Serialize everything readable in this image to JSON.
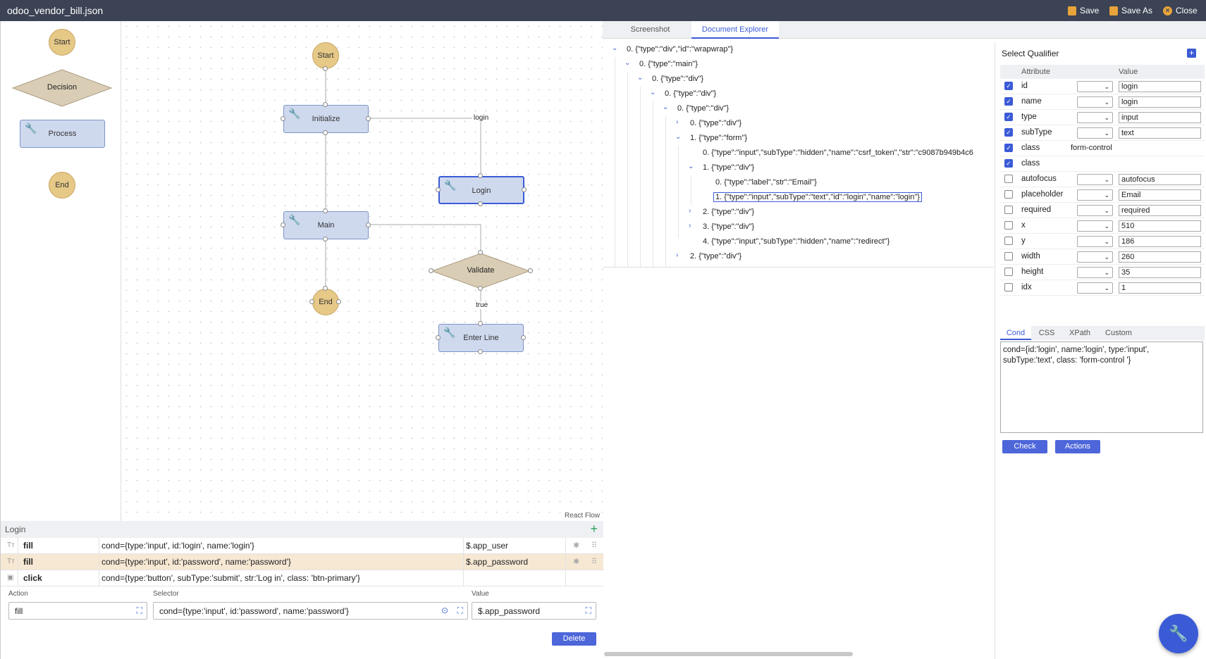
{
  "titlebar": {
    "filename": "odoo_vendor_bill.json",
    "save": "Save",
    "save_as": "Save As",
    "close": "Close"
  },
  "palette": {
    "start": "Start",
    "decision": "Decision",
    "process": "Process",
    "end": "End"
  },
  "flow": {
    "nodes": {
      "start": "Start",
      "initialize": "Initialize",
      "login": "Login",
      "main": "Main",
      "validate": "Validate",
      "end": "End",
      "enter_line": "Enter Line"
    },
    "edge_labels": {
      "login": "login",
      "true": "true"
    },
    "attribution": "React Flow"
  },
  "steps": {
    "title": "Login",
    "rows": [
      {
        "icon": "text-icon",
        "action": "fill",
        "selector": "cond={type:'input', id:'login', name:'login'}",
        "value": "$.app_user"
      },
      {
        "icon": "text-icon",
        "action": "fill",
        "selector": "cond={type:'input', id:'password', name:'password'}",
        "value": "$.app_password"
      },
      {
        "icon": "mouse-icon",
        "action": "click",
        "selector": "cond={type:'button', subType:'submit', str:'Log in', class: 'btn-primary'}",
        "value": ""
      }
    ],
    "editor": {
      "action_label": "Action",
      "selector_label": "Selector",
      "value_label": "Value",
      "action": "fill",
      "selector": "cond={type:'input', id:'password', name:'password'}",
      "value": "$.app_password",
      "delete": "Delete"
    }
  },
  "tabs": {
    "screenshot": "Screenshot",
    "document_explorer": "Document Explorer"
  },
  "tree": [
    "0. {\"type\":\"div\",\"id\":\"wrapwrap\"}",
    "0. {\"type\":\"main\"}",
    "0. {\"type\":\"div\"}",
    "0. {\"type\":\"div\"}",
    "0. {\"type\":\"div\"}",
    "0. {\"type\":\"div\"}",
    "1. {\"type\":\"form\"}",
    "0. {\"type\":\"input\",\"subType\":\"hidden\",\"name\":\"csrf_token\",\"str\":\"c9087b949b4c6",
    "1. {\"type\":\"div\"}",
    "0. {\"type\":\"label\",\"str\":\"Email\"}",
    "1. {\"type\":\"input\",\"subType\":\"text\",\"id\":\"login\",\"name\":\"login\"}",
    "2. {\"type\":\"div\"}",
    "3. {\"type\":\"div\"}",
    "4. {\"type\":\"input\",\"subType\":\"hidden\",\"name\":\"redirect\"}",
    "2. {\"type\":\"div\"}"
  ],
  "qualifier": {
    "title": "Select Qualifier",
    "col_attribute": "Attribute",
    "col_value": "Value",
    "rows": [
      {
        "name": "id",
        "checked": true,
        "value": "login"
      },
      {
        "name": "name",
        "checked": true,
        "value": "login"
      },
      {
        "name": "type",
        "checked": true,
        "value": "input"
      },
      {
        "name": "subType",
        "checked": true,
        "value": "text"
      },
      {
        "name": "class",
        "checked": true,
        "value": "form-control"
      },
      {
        "name": "class",
        "checked": true,
        "value": ""
      },
      {
        "name": "autofocus",
        "checked": false,
        "value": "autofocus"
      },
      {
        "name": "placeholder",
        "checked": false,
        "value": "Email"
      },
      {
        "name": "required",
        "checked": false,
        "value": "required"
      },
      {
        "name": "x",
        "checked": false,
        "value": "510"
      },
      {
        "name": "y",
        "checked": false,
        "value": "186"
      },
      {
        "name": "width",
        "checked": false,
        "value": "260"
      },
      {
        "name": "height",
        "checked": false,
        "value": "35"
      },
      {
        "name": "idx",
        "checked": false,
        "value": "1"
      }
    ],
    "tabs": [
      "Cond",
      "CSS",
      "XPath",
      "Custom"
    ],
    "cond_text": "cond={id:'login', name:'login', type:'input', subType:'text', class: 'form-control '}",
    "check": "Check",
    "actions": "Actions"
  },
  "colors": {
    "accent": "#3b5bd6",
    "titlebar": "#3b4354",
    "process_fill": "#cfd9ee",
    "terminal_fill": "#e6c887",
    "decision_fill": "#d9cdb5"
  }
}
